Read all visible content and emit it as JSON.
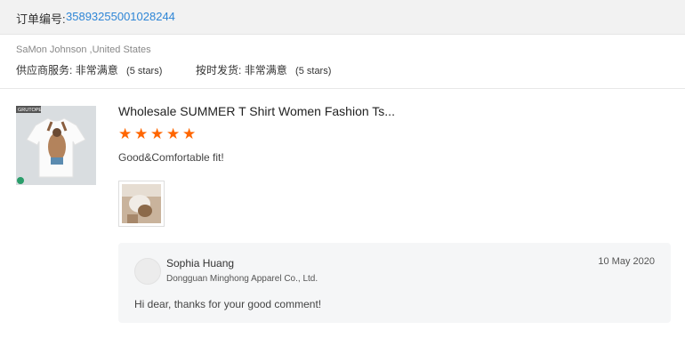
{
  "order": {
    "label": "订单编号:",
    "number": "35893255001028244"
  },
  "buyer": {
    "name_location": "SaMon Johnson ,United States"
  },
  "ratings": [
    {
      "label": "供应商服务:",
      "value": "非常满意",
      "stars_text": "(5 stars)"
    },
    {
      "label": "按时发货:",
      "value": "非常满意",
      "stars_text": "(5 stars)"
    }
  ],
  "product": {
    "title": "Wholesale SUMMER T Shirt Women Fashion Ts...",
    "rating": 5,
    "comment": "Good&Comfortable fit!",
    "thumb_brand": "GRUTOPE"
  },
  "reply": {
    "name": "Sophia Huang",
    "company": "Dongguan Minghong Apparel Co., Ltd.",
    "date": "10 May 2020",
    "text": "Hi dear, thanks for  your good comment!"
  },
  "colors": {
    "star": "#ff6600",
    "link": "#2f86d6",
    "header_bg": "#f2f2f2"
  }
}
